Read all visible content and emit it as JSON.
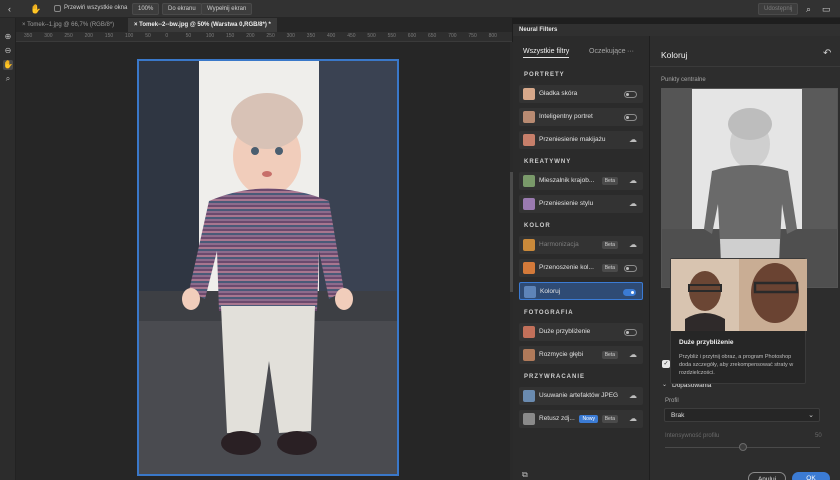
{
  "optbar": {
    "scroll_all_label": "Przewiń wszystkie okna",
    "zoom_value": "100%",
    "fit_screen_label": "Do ekranu",
    "fill_screen_label": "Wypełnij ekran",
    "share_label": "Udostępnij"
  },
  "tabs": [
    {
      "label": "Tomek--1.jpg @ 66,7% (RGB/8*)",
      "active": false
    },
    {
      "label": "Tomek--2--bw.jpg @ 50% (Warstwa 0,RGB/8*) *",
      "active": true
    }
  ],
  "ruler": [
    "350",
    "300",
    "250",
    "200",
    "150",
    "100",
    "50",
    "0",
    "50",
    "100",
    "150",
    "200",
    "250",
    "300",
    "350",
    "400",
    "450",
    "500",
    "550",
    "600",
    "650",
    "700",
    "750",
    "800"
  ],
  "neural_filters": {
    "panel_title": "Neural Filters",
    "subtabs": [
      "Wszystkie filtry",
      "Oczekujące"
    ],
    "more_label": "···",
    "sections": [
      {
        "title": "PORTRETY",
        "items": [
          {
            "label": "Gładka skóra",
            "control": "toggle",
            "on": false,
            "badge": "",
            "color": "#d7a88a"
          },
          {
            "label": "Inteligentny portret",
            "control": "toggle",
            "on": false,
            "badge": "",
            "color": "#b98b72"
          },
          {
            "label": "Przeniesienie makijażu",
            "control": "cloud",
            "on": false,
            "badge": "",
            "color": "#c77f6a"
          }
        ]
      },
      {
        "title": "KREATYWNY",
        "items": [
          {
            "label": "Mieszalnik krajob...",
            "control": "cloud",
            "on": false,
            "badge": "Beta",
            "color": "#7a9a6a"
          },
          {
            "label": "Przeniesienie stylu",
            "control": "cloud",
            "on": false,
            "badge": "",
            "color": "#9a7ab0"
          }
        ]
      },
      {
        "title": "KOLOR",
        "items": [
          {
            "label": "Harmonizacja",
            "control": "cloud",
            "on": false,
            "badge": "Beta",
            "color": "#c9893a",
            "dim": true
          },
          {
            "label": "Przenoszenie kol...",
            "control": "toggle",
            "on": false,
            "badge": "Beta",
            "color": "#d47a3a"
          },
          {
            "label": "Koloruj",
            "control": "toggle",
            "on": true,
            "badge": "",
            "color": "#5e84b8",
            "selected": true
          }
        ]
      },
      {
        "title": "FOTOGRAFIA",
        "items": [
          {
            "label": "Duże przybliżenie",
            "control": "toggle",
            "on": false,
            "badge": "",
            "color": "#c2705a"
          },
          {
            "label": "Rozmycie głębi",
            "control": "cloud",
            "on": false,
            "badge": "Beta",
            "color": "#b07a5a"
          }
        ]
      },
      {
        "title": "PRZYWRACANIE",
        "items": [
          {
            "label": "Usuwanie artefaktów JPEG",
            "control": "cloud",
            "on": false,
            "badge": "",
            "color": "#6a8bb0"
          },
          {
            "label": "Retusz zdj...",
            "control": "cloud",
            "on": false,
            "badge": "Beta",
            "badge2": "Nowy",
            "color": "#8a8a8a"
          }
        ]
      }
    ],
    "right": {
      "title": "Koloruj",
      "focal_points_label": "Punkty centralne",
      "tooltip_title": "Duże przybliżenie",
      "tooltip_text": "Przybliż i przytnij obraz, a program Photoshop doda szczegóły, aby zrekompensować straty w rozdzielczości.",
      "adjustments_label": "Dopasowania",
      "profile_label": "Profil",
      "profile_value": "Brak",
      "profile_strength_label": "Intensywność profilu",
      "profile_strength_value": "50",
      "cancel_label": "Anuluj",
      "ok_label": "OK"
    }
  }
}
